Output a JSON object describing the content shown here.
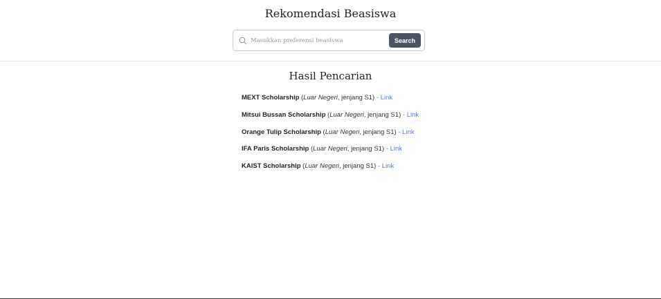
{
  "header": {
    "title": "Rekomendasi Beasiswa"
  },
  "search": {
    "placeholder": "Masukkan preferensi beasiswa",
    "value": "",
    "button_label": "Search",
    "icon": "search-icon"
  },
  "results": {
    "title": "Hasil Pencarian",
    "link_label": "Link",
    "separator": "-",
    "items": [
      {
        "name": "MEXT Scholarship",
        "location": "Luar Negeri",
        "level": "jenjang S1"
      },
      {
        "name": "Mitsui Bussan Scholarship",
        "location": "Luar Negeri",
        "level": "jenjang S1"
      },
      {
        "name": "Orange Tulip Scholarship",
        "location": "Luar Negeri",
        "level": "jenjang S1"
      },
      {
        "name": "IFA Paris Scholarship",
        "location": "Luar Negeri",
        "level": "jenjang S1"
      },
      {
        "name": "KAIST Scholarship",
        "location": "Luar Negeri",
        "level": "jenjang S1"
      }
    ]
  },
  "colors": {
    "button_bg": "#4b5563",
    "link": "#4f7fd8",
    "divider": "#e5e7eb"
  }
}
